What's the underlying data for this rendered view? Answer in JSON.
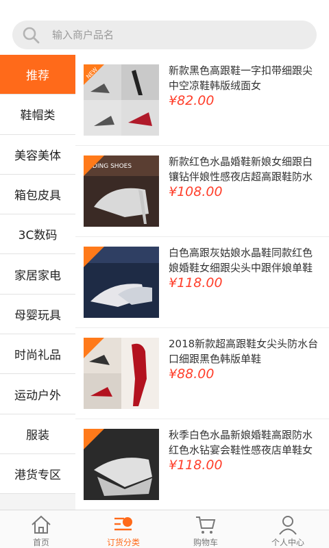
{
  "search": {
    "placeholder": "输入商户品名"
  },
  "sidebar": {
    "items": [
      {
        "label": "推荐",
        "active": true
      },
      {
        "label": "鞋帽类"
      },
      {
        "label": "美容美体"
      },
      {
        "label": "箱包皮具"
      },
      {
        "label": "3C数码"
      },
      {
        "label": "家居家电"
      },
      {
        "label": "母婴玩具"
      },
      {
        "label": "时尚礼品"
      },
      {
        "label": "运动户外"
      },
      {
        "label": "服装"
      },
      {
        "label": "港货专区"
      }
    ]
  },
  "products": [
    {
      "title1": "新款黑色高跟鞋一字扣带细跟尖",
      "title2": "中空凉鞋韩版绒面女",
      "price": "¥82.00",
      "badge": "NEW"
    },
    {
      "title1": "新款红色水晶婚鞋新娘女细跟白",
      "title2": "镶钻伴娘性感夜店超高跟鞋防水",
      "price": "¥108.00",
      "badge": "NEW"
    },
    {
      "title1": "白色高跟灰姑娘水晶鞋同款红色",
      "title2": "娘婚鞋女细跟尖头中跟伴娘单鞋",
      "price": "¥118.00",
      "badge": "NEW"
    },
    {
      "title1": "2018新款超高跟鞋女尖头防水台",
      "title2": "口细跟黑色韩版单鞋",
      "price": "¥88.00",
      "badge": "NEW"
    },
    {
      "title1": "秋季白色水晶新娘婚鞋高跟防水",
      "title2": "红色水钻宴会鞋性感夜店单鞋女",
      "price": "¥118.00",
      "badge": "NEW"
    }
  ],
  "tabbar": {
    "tabs": [
      {
        "label": "首页",
        "icon": "home-icon"
      },
      {
        "label": "订货分类",
        "icon": "category-icon",
        "active": true
      },
      {
        "label": "购物车",
        "icon": "cart-icon"
      },
      {
        "label": "个人中心",
        "icon": "user-icon"
      }
    ]
  },
  "colors": {
    "accent": "#ff6a1a",
    "price": "#ff3e2a"
  }
}
